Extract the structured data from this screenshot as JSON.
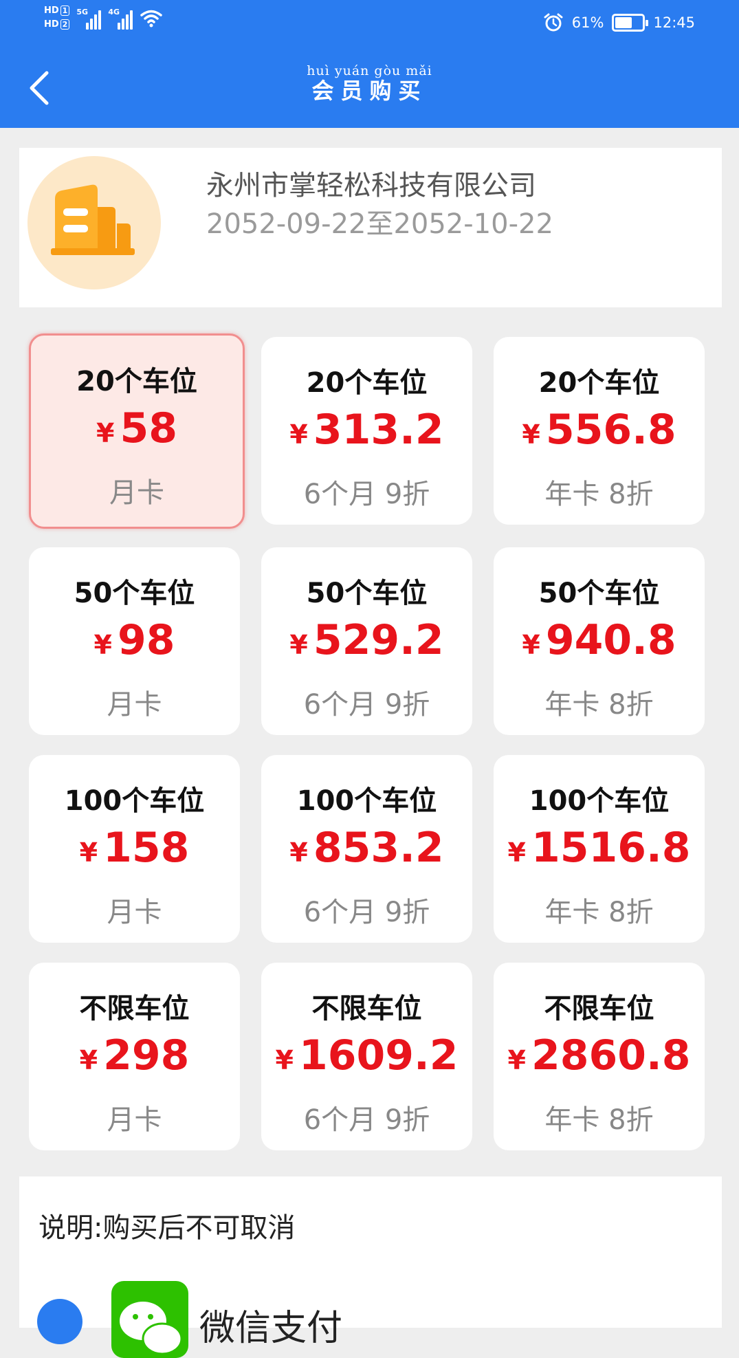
{
  "status_bar": {
    "hd1": "HD",
    "hd1_num": "1",
    "hd2": "HD",
    "hd2_num": "2",
    "sig1": "5G",
    "sig2": "4G",
    "battery_pct_label": "61%",
    "battery_level": 0.61,
    "time": "12:45"
  },
  "nav": {
    "pinyin": "huì yuán gòu mǎi",
    "title": "会员购买"
  },
  "company": {
    "name": "永州市掌轻松科技有限公司",
    "dates": "2052-09-22至2052-10-22"
  },
  "plans": [
    {
      "slots": "20个车位",
      "currency": "¥",
      "price": "58",
      "desc": "月卡",
      "selected": true
    },
    {
      "slots": "20个车位",
      "currency": "¥",
      "price": "313.2",
      "desc": "6个月 9折",
      "selected": false
    },
    {
      "slots": "20个车位",
      "currency": "¥",
      "price": "556.8",
      "desc": "年卡 8折",
      "selected": false
    },
    {
      "slots": "50个车位",
      "currency": "¥",
      "price": "98",
      "desc": "月卡",
      "selected": false
    },
    {
      "slots": "50个车位",
      "currency": "¥",
      "price": "529.2",
      "desc": "6个月 9折",
      "selected": false
    },
    {
      "slots": "50个车位",
      "currency": "¥",
      "price": "940.8",
      "desc": "年卡 8折",
      "selected": false
    },
    {
      "slots": "100个车位",
      "currency": "¥",
      "price": "158",
      "desc": "月卡",
      "selected": false
    },
    {
      "slots": "100个车位",
      "currency": "¥",
      "price": "853.2",
      "desc": "6个月 9折",
      "selected": false
    },
    {
      "slots": "100个车位",
      "currency": "¥",
      "price": "1516.8",
      "desc": "年卡 8折",
      "selected": false
    },
    {
      "slots": "不限车位",
      "currency": "¥",
      "price": "298",
      "desc": "月卡",
      "selected": false
    },
    {
      "slots": "不限车位",
      "currency": "¥",
      "price": "1609.2",
      "desc": "6个月 9折",
      "selected": false
    },
    {
      "slots": "不限车位",
      "currency": "¥",
      "price": "2860.8",
      "desc": "年卡 8折",
      "selected": false
    }
  ],
  "notice": "说明:购买后不可取消",
  "payment": {
    "method_label": "微信支付",
    "icon": "wechat-pay-icon"
  },
  "colors": {
    "header": "#2a7cf0",
    "price": "#e8141c",
    "selected_bg": "#fde9e6",
    "selected_border": "#f18e8e"
  }
}
